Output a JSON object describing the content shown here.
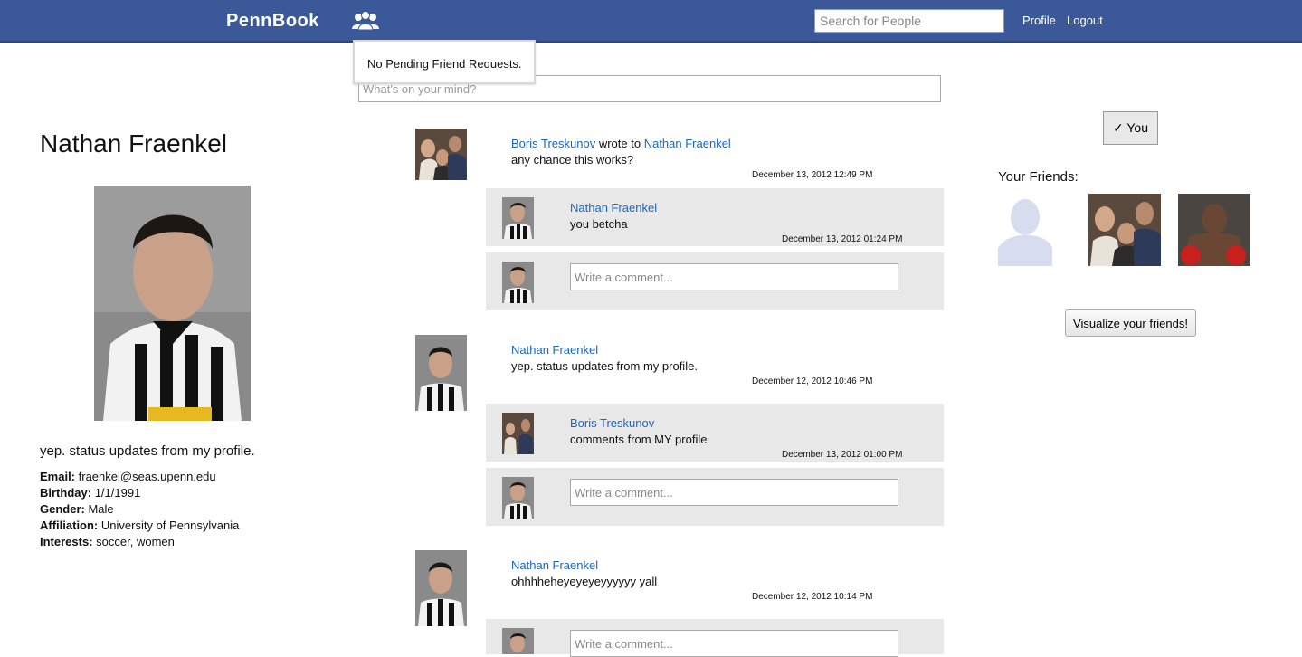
{
  "header": {
    "brand": "PennBook",
    "search_placeholder": "Search for People",
    "profile_link": "Profile",
    "logout_link": "Logout",
    "friend_requests_icon": "friend-requests-icon"
  },
  "friend_requests_popup": {
    "text": "No Pending Friend Requests."
  },
  "status_box": {
    "placeholder": "What's on your mind?"
  },
  "profile": {
    "name": "Nathan Fraenkel",
    "status": "yep. status updates from my profile.",
    "info": [
      {
        "label": "Email:",
        "value": "fraenkel@seas.upenn.edu"
      },
      {
        "label": "Birthday:",
        "value": "1/1/1991"
      },
      {
        "label": "Gender:",
        "value": "Male"
      },
      {
        "label": "Affiliation:",
        "value": "University of Pennsylvania"
      },
      {
        "label": "Interests:",
        "value": "soccer, women"
      }
    ]
  },
  "feed": {
    "comment_placeholder": "Write a comment...",
    "posts": [
      {
        "author": "Boris Treskunov",
        "verb": "wrote to",
        "target": "Nathan Fraenkel",
        "text": "any chance this works?",
        "time": "December 13, 2012 12:49 PM",
        "comments": [
          {
            "author": "Nathan Fraenkel",
            "text": "you betcha",
            "time": "December 13, 2012 01:24 PM"
          }
        ]
      },
      {
        "author": "Nathan Fraenkel",
        "text": "yep. status updates from my profile.",
        "time": "December 12, 2012 10:46 PM",
        "comments": [
          {
            "author": "Boris Treskunov",
            "text": "comments from MY profile",
            "time": "December 13, 2012 01:00 PM"
          }
        ]
      },
      {
        "author": "Nathan Fraenkel",
        "text": "ohhhheheyeyeyeyyyyyy yall",
        "time": "December 12, 2012 10:14 PM",
        "comments": []
      }
    ]
  },
  "sidebar": {
    "you_button": "✓ You",
    "friends_heading": "Your Friends:",
    "visualize_button": "Visualize your friends!"
  },
  "colors": {
    "topbar": "#3b5998",
    "link": "#1c64c4",
    "comment_bg": "#e8e8e8"
  }
}
